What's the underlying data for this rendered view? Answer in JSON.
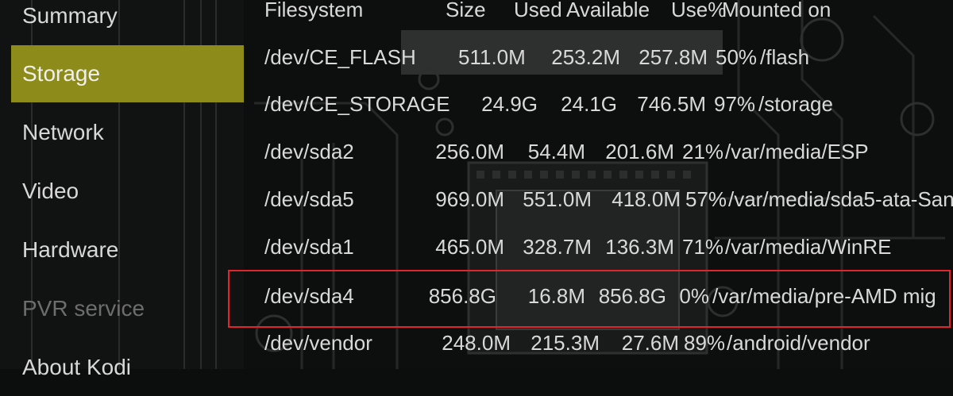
{
  "sidebar": {
    "items": [
      {
        "label": "Summary"
      },
      {
        "label": "Storage"
      },
      {
        "label": "Network"
      },
      {
        "label": "Video"
      },
      {
        "label": "Hardware"
      },
      {
        "label": "PVR service"
      },
      {
        "label": "About Kodi"
      }
    ],
    "selected": "Storage",
    "disabled": "PVR service",
    "selected_color": "#8d8c1b"
  },
  "table": {
    "header": {
      "filesystem": "Filesystem",
      "size": "Size",
      "used": "Used",
      "available": "Available",
      "use_pct": "Use%",
      "mounted_on": "Mounted on"
    },
    "rows": [
      {
        "filesystem": "/dev/CE_FLASH",
        "size": "511.0M",
        "used": "253.2M",
        "available": "257.8M",
        "use_pct": "50%",
        "mounted_on": "/flash"
      },
      {
        "filesystem": "/dev/CE_STORAGE",
        "size": "24.9G",
        "used": "24.1G",
        "available": "746.5M",
        "use_pct": "97%",
        "mounted_on": "/storage"
      },
      {
        "filesystem": "/dev/sda2",
        "size": "256.0M",
        "used": "54.4M",
        "available": "201.6M",
        "use_pct": "21%",
        "mounted_on": "/var/media/ESP"
      },
      {
        "filesystem": "/dev/sda5",
        "size": "969.0M",
        "used": "551.0M",
        "available": "418.0M",
        "use_pct": "57%",
        "mounted_on": "/var/media/sda5-ata-San"
      },
      {
        "filesystem": "/dev/sda1",
        "size": "465.0M",
        "used": "328.7M",
        "available": "136.3M",
        "use_pct": "71%",
        "mounted_on": "/var/media/WinRE"
      },
      {
        "filesystem": "/dev/sda4",
        "size": "856.8G",
        "used": "16.8M",
        "available": "856.8G",
        "use_pct": "0%",
        "mounted_on": "/var/media/pre-AMD mig"
      },
      {
        "filesystem": "/dev/vendor",
        "size": "248.0M",
        "used": "215.3M",
        "available": "27.6M",
        "use_pct": "89%",
        "mounted_on": "/android/vendor"
      }
    ],
    "highlighted_row": "/dev/sda4",
    "highlight_color": "#e0262c"
  }
}
